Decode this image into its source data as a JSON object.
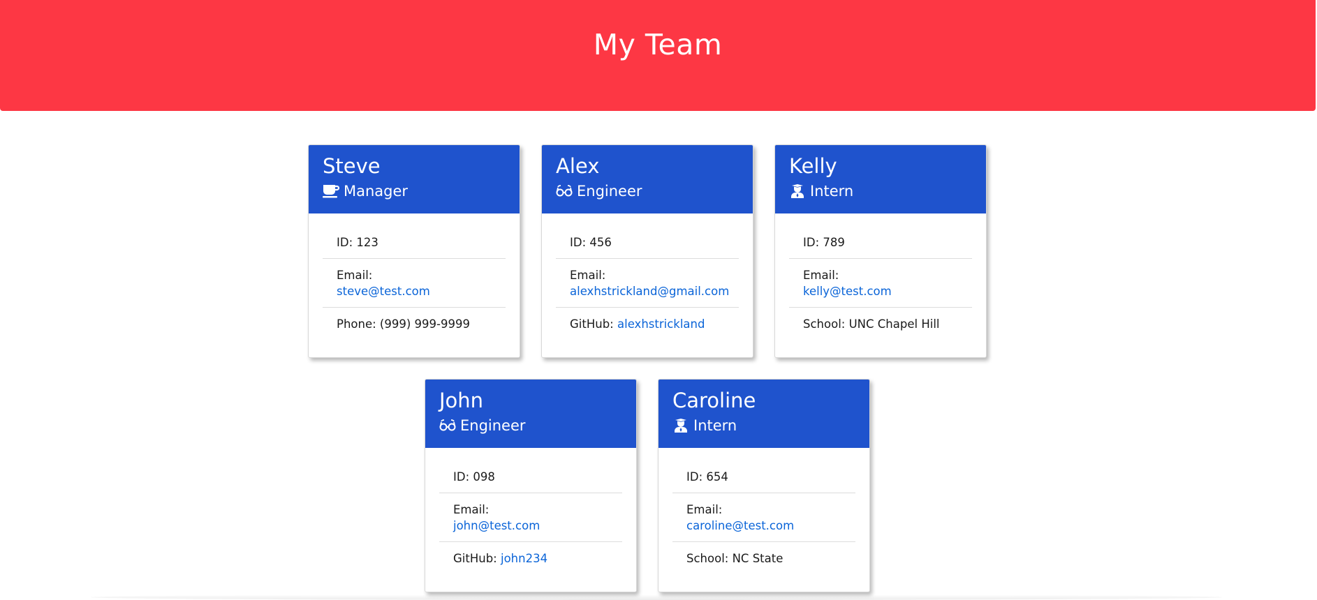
{
  "header": {
    "title": "My Team"
  },
  "employees": [
    {
      "name": "Steve",
      "role": "Manager",
      "icon": "coffee-icon",
      "id_text": "ID: 123",
      "email_label": "Email:",
      "email": "steve@test.com",
      "extra_label": "Phone:",
      "extra_value": "(999) 999-9999"
    },
    {
      "name": "Alex",
      "role": "Engineer",
      "icon": "glasses-icon",
      "id_text": "ID: 456",
      "email_label": "Email:",
      "email": "alexhstrickland@gmail.com",
      "extra_label": "GitHub:",
      "extra_value": "alexhstrickland"
    },
    {
      "name": "Kelly",
      "role": "Intern",
      "icon": "graduate-icon",
      "id_text": "ID: 789",
      "email_label": "Email:",
      "email": "kelly@test.com",
      "extra_label": "School:",
      "extra_value": "UNC Chapel Hill"
    },
    {
      "name": "John",
      "role": "Engineer",
      "icon": "glasses-icon",
      "id_text": "ID: 098",
      "email_label": "Email:",
      "email": "john@test.com",
      "extra_label": "GitHub:",
      "extra_value": "john234"
    },
    {
      "name": "Caroline",
      "role": "Intern",
      "icon": "graduate-icon",
      "id_text": "ID: 654",
      "email_label": "Email:",
      "email": "caroline@test.com",
      "extra_label": "School:",
      "extra_value": "NC State"
    }
  ],
  "colors": {
    "header_bg": "#fd3744",
    "card_header_bg": "#1f53cd",
    "link": "#0a64d8"
  }
}
